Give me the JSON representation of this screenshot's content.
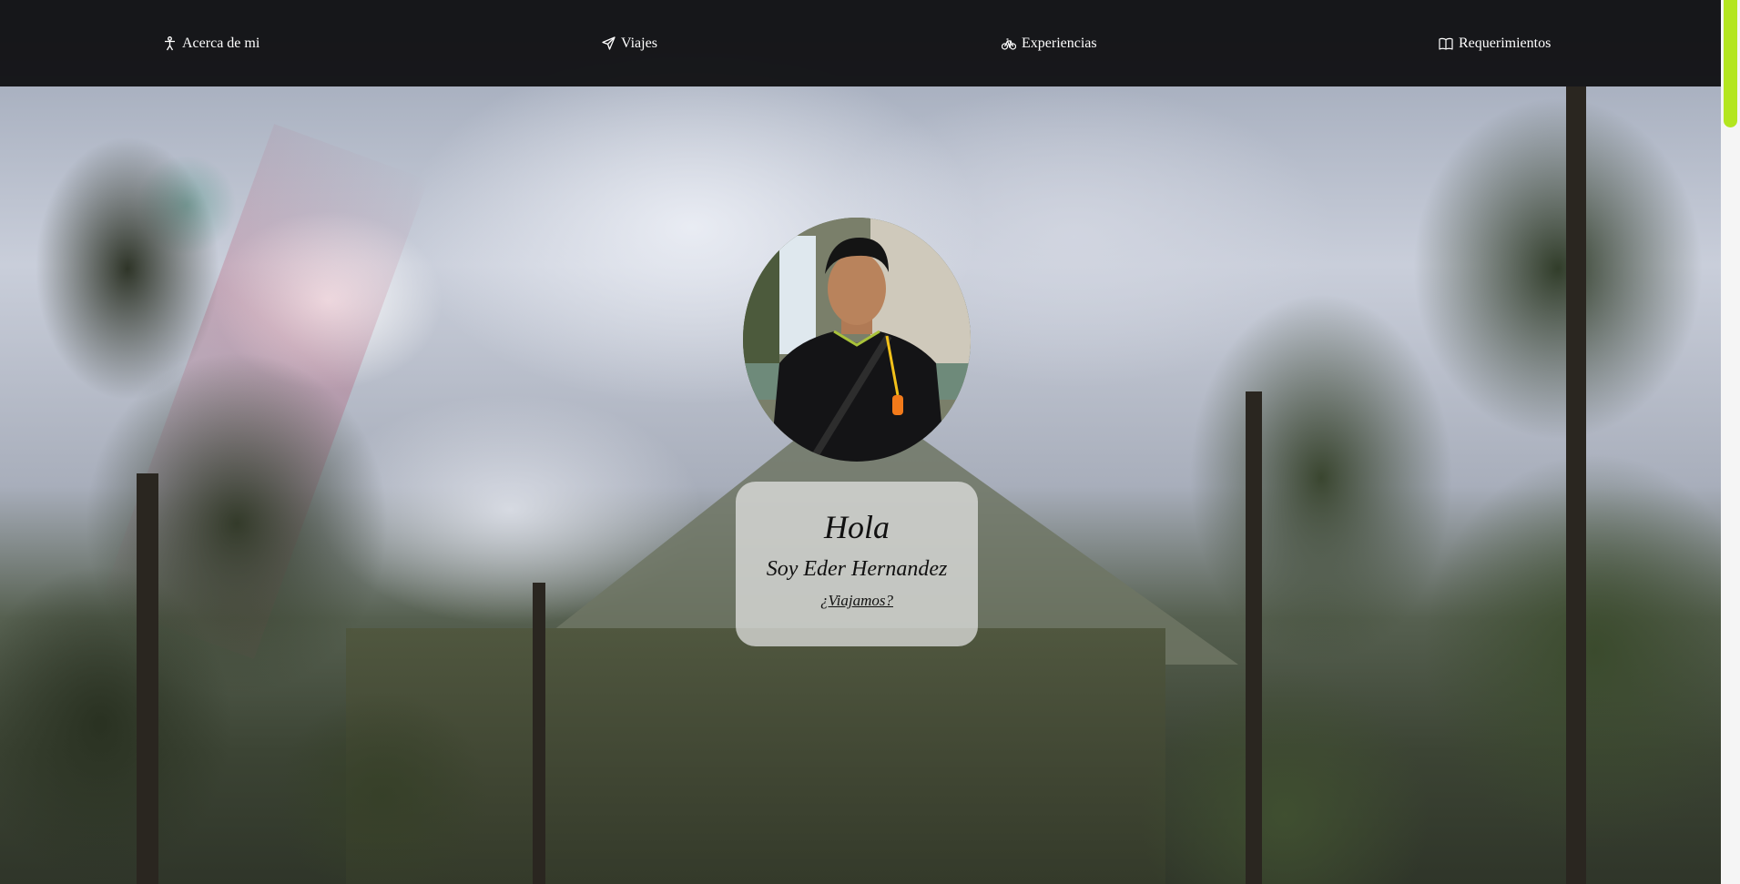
{
  "nav": {
    "items": [
      {
        "label": "Acerca de mi",
        "icon": "person-icon"
      },
      {
        "label": "Viajes",
        "icon": "send-icon"
      },
      {
        "label": "Experiencias",
        "icon": "bicycle-icon"
      },
      {
        "label": "Requerimientos",
        "icon": "book-icon"
      }
    ]
  },
  "hero": {
    "greeting": "Hola",
    "name": "Soy Eder Hernandez",
    "cta": "¿Viajamos?"
  },
  "colors": {
    "nav_bg": "#0c0c0e",
    "nav_text": "#ffffff",
    "scroll_thumb": "#b3e61f",
    "card_bg": "#e6e6e6"
  }
}
